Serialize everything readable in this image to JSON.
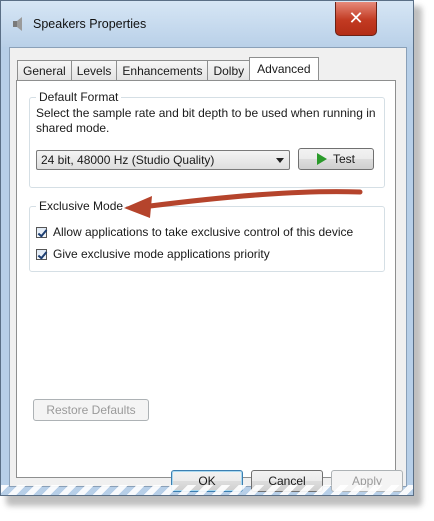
{
  "window": {
    "title": "Speakers Properties",
    "close_glyph": "✕"
  },
  "tabs": [
    {
      "label": "General",
      "active": false
    },
    {
      "label": "Levels",
      "active": false
    },
    {
      "label": "Enhancements",
      "active": false
    },
    {
      "label": "Dolby",
      "active": false
    },
    {
      "label": "Advanced",
      "active": true
    }
  ],
  "default_format": {
    "group_label": "Default Format",
    "description": "Select the sample rate and bit depth to be used when running in shared mode.",
    "selected_format": "24 bit, 48000 Hz (Studio Quality)",
    "test_label": "Test"
  },
  "exclusive_mode": {
    "group_label": "Exclusive Mode",
    "options": [
      {
        "label": "Allow applications to take exclusive control of this device",
        "checked": true
      },
      {
        "label": "Give exclusive mode applications priority",
        "checked": true
      }
    ]
  },
  "restore_label": "Restore Defaults",
  "footer": {
    "ok_label": "OK",
    "cancel_label": "Cancel",
    "apply_label": "Apply"
  },
  "colors": {
    "annotation_arrow": "#b5442c",
    "play_icon": "#2a9a2a",
    "close_button": "#c23a22"
  },
  "icons": [
    "speaker-icon",
    "close-icon",
    "play-icon",
    "chevron-down-icon",
    "checkmark-icon"
  ]
}
